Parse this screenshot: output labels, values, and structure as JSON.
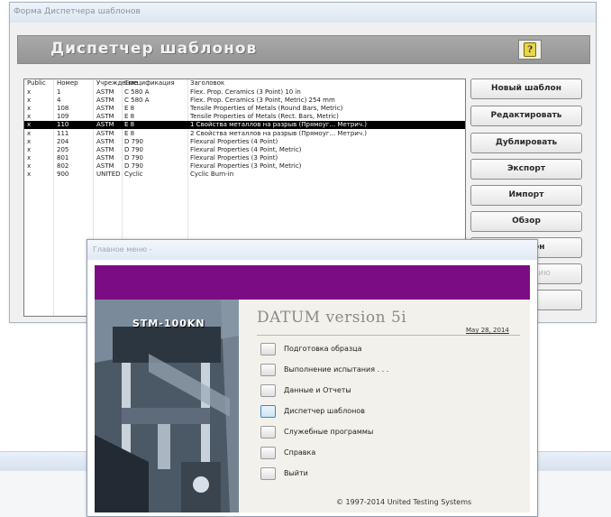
{
  "template_manager": {
    "window_title": "Форма Диспетчера шаблонов",
    "header_title": "Диспетчер шаблонов",
    "help_label": "?",
    "columns": [
      "Public",
      "Номер",
      "Учреждение",
      "Спецификация",
      "Заголовок"
    ],
    "rows": [
      {
        "pub": "x",
        "num": "1",
        "org": "ASTM",
        "spec": "C 580 A",
        "title": "Flex. Prop. Ceramics (3 Point) 10 in",
        "selected": false
      },
      {
        "pub": "x",
        "num": "4",
        "org": "ASTM",
        "spec": "C 580 A",
        "title": "Flex. Prop. Ceramics (3 Point, Metric) 254 mm",
        "selected": false
      },
      {
        "pub": "x",
        "num": "108",
        "org": "ASTM",
        "spec": "E 8",
        "title": "Tensile Properties of Metals (Round Bars, Metric)",
        "selected": false
      },
      {
        "pub": "x",
        "num": "109",
        "org": "ASTM",
        "spec": "E 8",
        "title": "Tensile Properties of Metals (Rect. Bars, Metric)",
        "selected": false
      },
      {
        "pub": "x",
        "num": "110",
        "org": "ASTM",
        "spec": "E 8",
        "title": "1 Свойства металлов на разрыв (Прямоуг... Метрич.)",
        "selected": true
      },
      {
        "pub": "x",
        "num": "111",
        "org": "ASTM",
        "spec": "E 8",
        "title": "2 Свойства металлов на разрыв (Прямоуг... Метрич.)",
        "selected": false
      },
      {
        "pub": "x",
        "num": "204",
        "org": "ASTM",
        "spec": "D 790",
        "title": "Flexural Properties (4 Point)",
        "selected": false
      },
      {
        "pub": "x",
        "num": "205",
        "org": "ASTM",
        "spec": "D 790",
        "title": "Flexural Properties (4 Point, Metric)",
        "selected": false
      },
      {
        "pub": "x",
        "num": "801",
        "org": "ASTM",
        "spec": "D 790",
        "title": "Flexural Properties (3 Point)",
        "selected": false
      },
      {
        "pub": "x",
        "num": "802",
        "org": "ASTM",
        "spec": "D 790",
        "title": "Flexural Properties (3 Point, Metric)",
        "selected": false
      },
      {
        "pub": "x",
        "num": "900",
        "org": "UNITED",
        "spec": "Cyclic",
        "title": "Cyclic Burn-in",
        "selected": false
      }
    ],
    "buttons": [
      {
        "label": "Новый шаблон",
        "enabled": true
      },
      {
        "label": "Редактировать",
        "enabled": true
      },
      {
        "label": "Дублировать",
        "enabled": true
      },
      {
        "label": "Экспорт",
        "enabled": true
      },
      {
        "label": "Импорт",
        "enabled": true
      },
      {
        "label": "Обзор",
        "enabled": true
      },
      {
        "label": "шаблон",
        "enabled": true
      },
      {
        "label": "омолчанию",
        "enabled": false
      },
      {
        "label": "д",
        "enabled": true
      }
    ]
  },
  "main_menu": {
    "window_title": "Главное меню -",
    "photo_label": "STM-100KN",
    "version": "DATUM version 5i",
    "date": "May 28, 2014",
    "items": [
      {
        "label": "Подготовка образца",
        "highlighted": false
      },
      {
        "label": "Выполнение испытания . . .",
        "highlighted": false
      },
      {
        "label": "Данные и Отчеты",
        "highlighted": false
      },
      {
        "label": "Диспетчер шаблонов",
        "highlighted": true
      },
      {
        "label": "Служебные программы",
        "highlighted": false
      },
      {
        "label": "Справка",
        "highlighted": false
      },
      {
        "label": "Выйти",
        "highlighted": false
      }
    ],
    "copyright": "© 1997-2014 United Testing Systems"
  },
  "colors": {
    "accent_purple": "#7c0c83",
    "selection": "#000000",
    "header_gray": "#9e9e9e"
  }
}
